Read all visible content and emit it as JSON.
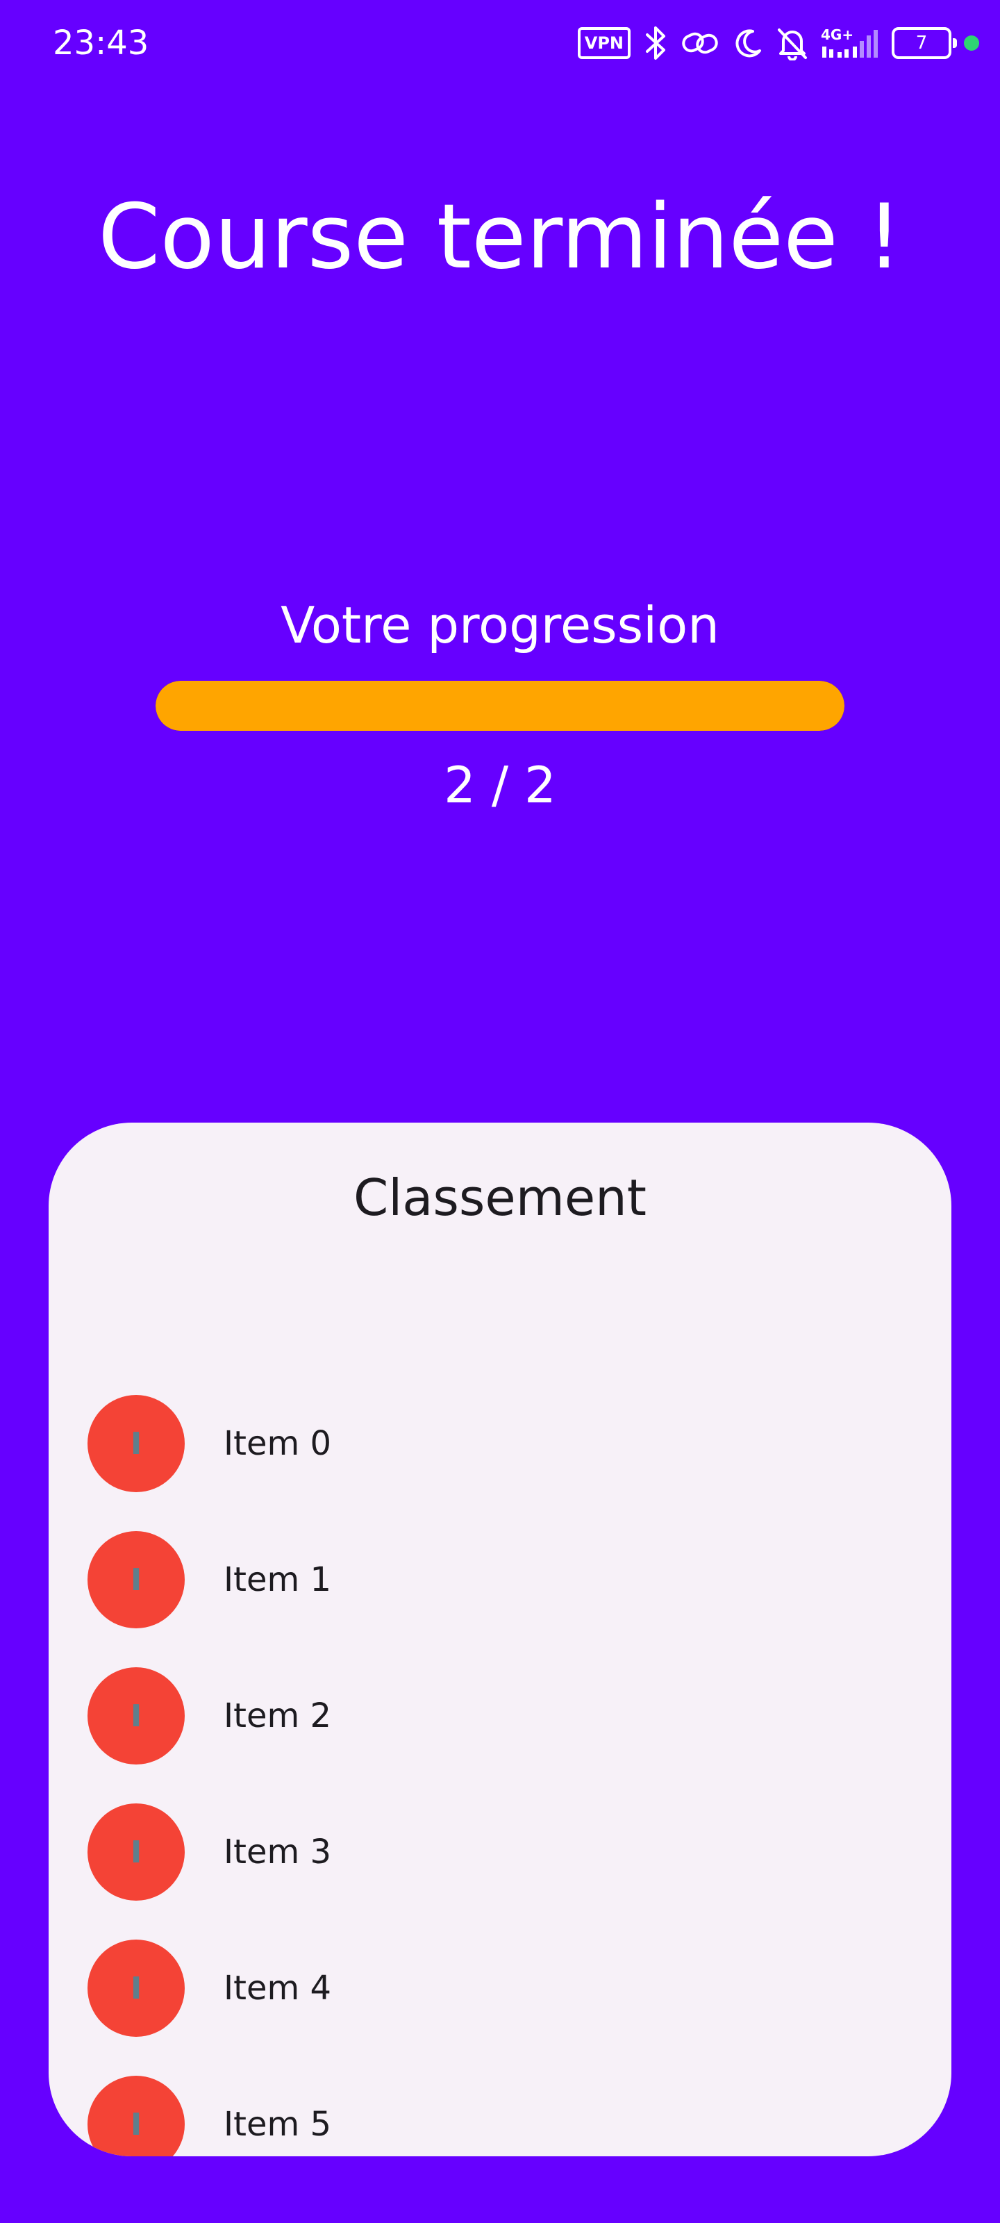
{
  "status_bar": {
    "time": "23:43",
    "vpn_label": "VPN",
    "network_label": "4G+",
    "battery_level": "7",
    "icons": [
      "vpn-icon",
      "bluetooth-icon",
      "link-icon",
      "moon-icon",
      "bell-off-icon",
      "signal-icon",
      "battery-icon",
      "green-dot"
    ]
  },
  "header": {
    "title": "Course terminée !"
  },
  "progress": {
    "label": "Votre progression",
    "count_text": "2 / 2",
    "current": 2,
    "total": 2,
    "fill_percent": 100,
    "fill_color": "#FFA500"
  },
  "ranking": {
    "title": "Classement",
    "avatar_letter": "I",
    "avatar_color": "#F44336",
    "items": [
      {
        "label": "Item 0"
      },
      {
        "label": "Item 1"
      },
      {
        "label": "Item 2"
      },
      {
        "label": "Item 3"
      },
      {
        "label": "Item 4"
      },
      {
        "label": "Item 5"
      }
    ]
  },
  "colors": {
    "background": "#6600FF",
    "card": "#F7F1F8"
  }
}
